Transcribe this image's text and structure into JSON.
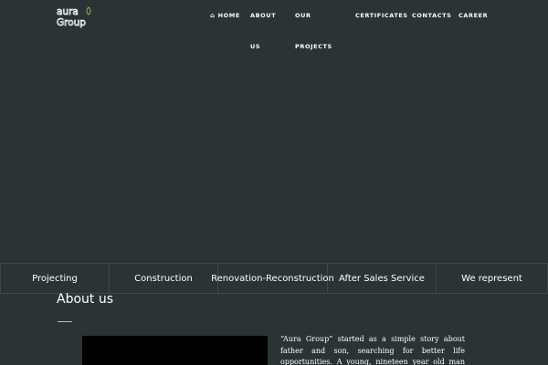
{
  "logo": {
    "line1": "aura",
    "line2": "Group"
  },
  "nav": {
    "home": "HOME",
    "about": "ABOUT US",
    "projects": "OUR PROJECTS",
    "certificates": "CERTIFICATES",
    "contacts": "CONTACTS",
    "career": "CAREER"
  },
  "services": [
    "Projecting",
    "Construction",
    "Renovation-Reconstruction",
    "After Sales Service",
    "We represent"
  ],
  "about": {
    "title": "About us",
    "text": "“Aura Group” started as a simple story about father and son, searching for better life opportunities. A young, nineteen year old man joined his father in construction"
  },
  "colors": {
    "background": "#2c3335",
    "divider": "#3f4749",
    "logo_accent": "#8dc63f"
  }
}
